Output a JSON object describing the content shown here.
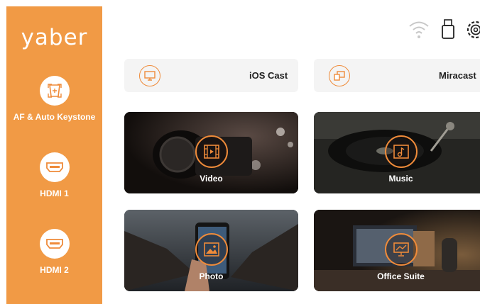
{
  "sidebar": {
    "logo": "yaber",
    "items": [
      {
        "label": "AF & Auto Keystone",
        "icon": "keystone-icon"
      },
      {
        "label": "HDMI 1",
        "icon": "hdmi-icon"
      },
      {
        "label": "HDMI 2",
        "icon": "hdmi-icon"
      }
    ]
  },
  "status_icons": [
    "wifi-icon",
    "usb-icon",
    "settings-gear-icon"
  ],
  "cast": [
    {
      "label": "iOS Cast",
      "icon": "screen-mirror-icon"
    },
    {
      "label": "Miracast",
      "icon": "devices-icon"
    }
  ],
  "tiles": [
    {
      "label": "Video",
      "icon": "film-play-icon"
    },
    {
      "label": "Music",
      "icon": "music-note-icon"
    },
    {
      "label": "Photo",
      "icon": "image-icon"
    },
    {
      "label": "Office Suite",
      "icon": "presentation-icon"
    }
  ],
  "colors": {
    "sidebar": "#f19a45",
    "accent": "#ef8b3a",
    "card": "#f4f4f4"
  }
}
